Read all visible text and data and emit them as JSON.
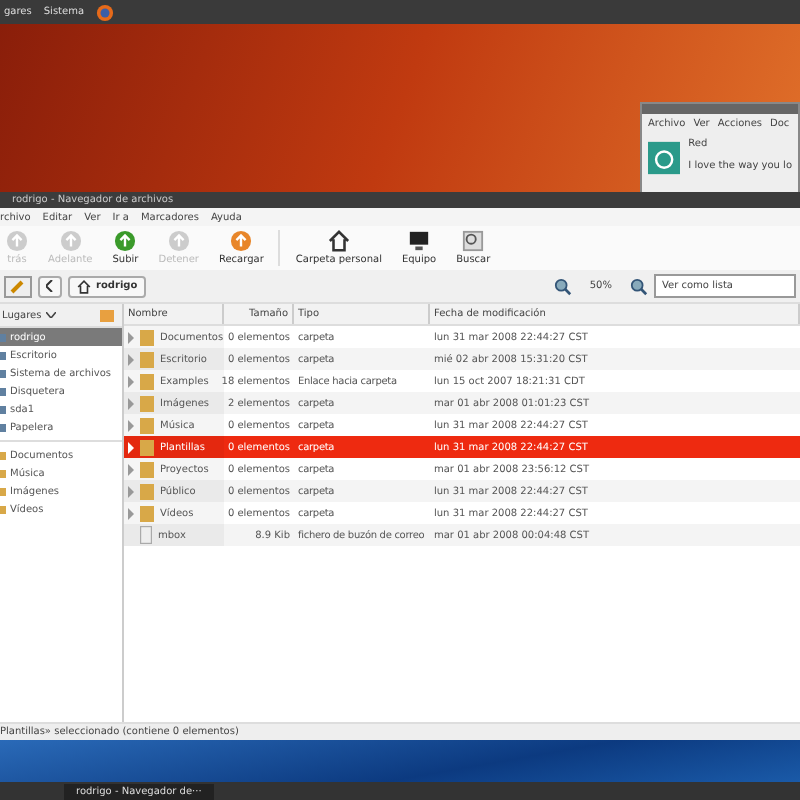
{
  "top_panel": {
    "menus": [
      "gares",
      "Sistema"
    ]
  },
  "chat_window": {
    "menus": [
      "Archivo",
      "Ver",
      "Acciones",
      "Doc"
    ],
    "contact": "Red",
    "message": "I love the way you lo"
  },
  "window": {
    "title": "rodrigo - Navegador de archivos"
  },
  "menu_bar": [
    "rchivo",
    "Editar",
    "Ver",
    "Ir a",
    "Marcadores",
    "Ayuda"
  ],
  "toolbar": [
    {
      "label": "trás",
      "kind": "back",
      "disabled": true
    },
    {
      "label": "Adelante",
      "kind": "forward",
      "disabled": true
    },
    {
      "label": "Subir",
      "kind": "up",
      "disabled": false
    },
    {
      "label": "Detener",
      "kind": "stop",
      "disabled": true
    },
    {
      "label": "Recargar",
      "kind": "reload",
      "disabled": false
    },
    {
      "label": "Carpeta personal",
      "kind": "home",
      "disabled": false
    },
    {
      "label": "Equipo",
      "kind": "computer",
      "disabled": false
    },
    {
      "label": "Buscar",
      "kind": "search",
      "disabled": false
    }
  ],
  "location": {
    "path_button": "rodrigo",
    "zoom": "50%",
    "view_mode": "Ver como lista"
  },
  "sidebar": {
    "title": "Lugares",
    "items": [
      {
        "label": "rodrigo",
        "selected": true
      },
      {
        "label": "Escritorio",
        "selected": false
      },
      {
        "label": "Sistema de archivos",
        "selected": false
      },
      {
        "label": "Disquetera",
        "selected": false
      },
      {
        "label": "sda1",
        "selected": false
      },
      {
        "label": "Papelera",
        "selected": false
      }
    ],
    "bookmarks": [
      {
        "label": "Documentos",
        "selected": false
      },
      {
        "label": "Música",
        "selected": false
      },
      {
        "label": "Imágenes",
        "selected": false
      },
      {
        "label": "Vídeos",
        "selected": false
      }
    ]
  },
  "table": {
    "columns": [
      "Nombre",
      "Tamaño",
      "Tipo",
      "Fecha de modificación"
    ],
    "rows": [
      {
        "name": "Documentos",
        "size": "0 elementos",
        "type": "carpeta",
        "date": "lun 31 mar 2008 22:44:27 CST",
        "kind": "folder",
        "selected": false
      },
      {
        "name": "Escritorio",
        "size": "0 elementos",
        "type": "carpeta",
        "date": "mié 02 abr 2008 15:31:20 CST",
        "kind": "folder",
        "selected": false
      },
      {
        "name": "Examples",
        "size": "18 elementos",
        "type": "Enlace hacia carpeta",
        "date": "lun 15 oct 2007 18:21:31 CDT",
        "kind": "folder",
        "selected": false
      },
      {
        "name": "Imágenes",
        "size": "2 elementos",
        "type": "carpeta",
        "date": "mar 01 abr 2008 01:01:23 CST",
        "kind": "folder",
        "selected": false
      },
      {
        "name": "Música",
        "size": "0 elementos",
        "type": "carpeta",
        "date": "lun 31 mar 2008 22:44:27 CST",
        "kind": "folder",
        "selected": false
      },
      {
        "name": "Plantillas",
        "size": "0 elementos",
        "type": "carpeta",
        "date": "lun 31 mar 2008 22:44:27 CST",
        "kind": "folder",
        "selected": true
      },
      {
        "name": "Proyectos",
        "size": "0 elementos",
        "type": "carpeta",
        "date": "mar 01 abr 2008 23:56:12 CST",
        "kind": "folder",
        "selected": false
      },
      {
        "name": "Público",
        "size": "0 elementos",
        "type": "carpeta",
        "date": "lun 31 mar 2008 22:44:27 CST",
        "kind": "folder",
        "selected": false
      },
      {
        "name": "Vídeos",
        "size": "0 elementos",
        "type": "carpeta",
        "date": "lun 31 mar 2008 22:44:27 CST",
        "kind": "folder",
        "selected": false
      },
      {
        "name": "mbox",
        "size": "8.9 Kib",
        "type": "fichero de buzón de correo",
        "date": "mar 01 abr 2008 00:04:48 CST",
        "kind": "file",
        "selected": false
      }
    ]
  },
  "status_bar": "Plantillas» seleccionado (contiene 0 elementos)",
  "taskbar": {
    "tasks": [
      "rodrigo - Navegador de···"
    ]
  }
}
